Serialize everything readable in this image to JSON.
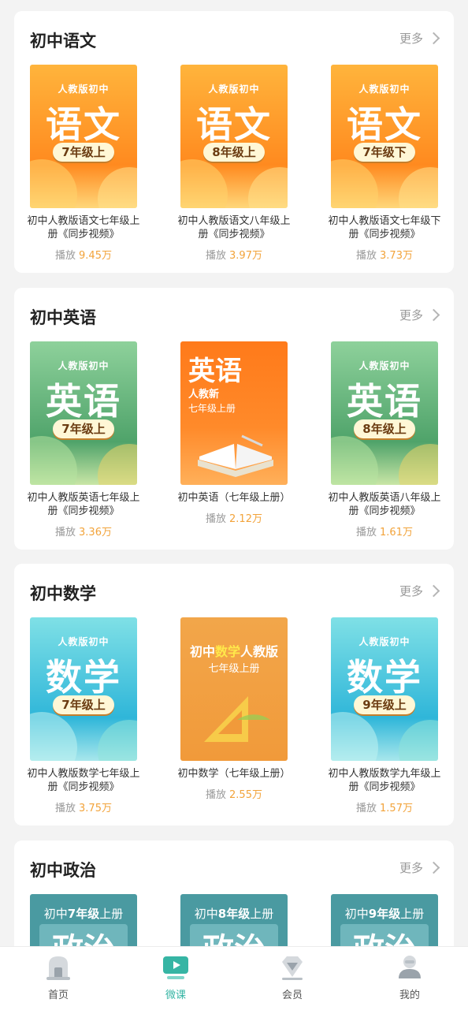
{
  "sections": [
    {
      "title": "初中语文",
      "more": "更多",
      "items": [
        {
          "name": "初中人教版语文七年级上册《同步视频》",
          "plays_label": "播放",
          "plays": "9.45万",
          "cover": {
            "publisher": "人教版初中",
            "subject": "语文",
            "grade": "7年级上",
            "theme": "orange"
          }
        },
        {
          "name": "初中人教版语文八年级上册《同步视频》",
          "plays_label": "播放",
          "plays": "3.97万",
          "cover": {
            "publisher": "人教版初中",
            "subject": "语文",
            "grade": "8年级上",
            "theme": "orange"
          }
        },
        {
          "name": "初中人教版语文七年级下册《同步视频》",
          "plays_label": "播放",
          "plays": "3.73万",
          "cover": {
            "publisher": "人教版初中",
            "subject": "语文",
            "grade": "7年级下",
            "theme": "orange"
          }
        }
      ]
    },
    {
      "title": "初中英语",
      "more": "更多",
      "items": [
        {
          "name": "初中人教版英语七年级上册《同步视频》",
          "plays_label": "播放",
          "plays": "3.36万",
          "cover": {
            "publisher": "人教版初中",
            "subject": "英语",
            "grade": "7年级上",
            "theme": "green"
          }
        },
        {
          "name": "初中英语（七年级上册）",
          "plays_label": "播放",
          "plays": "2.12万",
          "cover": {
            "subject": "英语",
            "line1": "人教新",
            "line2": "七年级上册",
            "theme": "english-tile"
          }
        },
        {
          "name": "初中人教版英语八年级上册《同步视频》",
          "plays_label": "播放",
          "plays": "1.61万",
          "cover": {
            "publisher": "人教版初中",
            "subject": "英语",
            "grade": "8年级上",
            "theme": "green"
          }
        }
      ]
    },
    {
      "title": "初中数学",
      "more": "更多",
      "items": [
        {
          "name": "初中人教版数学七年级上册《同步视频》",
          "plays_label": "播放",
          "plays": "3.75万",
          "cover": {
            "publisher": "人教版初中",
            "subject": "数学",
            "grade": "7年级上",
            "theme": "cyan"
          }
        },
        {
          "name": "初中数学（七年级上册）",
          "plays_label": "播放",
          "plays": "2.55万",
          "cover": {
            "prefix": "初中",
            "subject": "数学",
            "suffix": "人教版",
            "line2": "七年级上册",
            "theme": "math-tile"
          }
        },
        {
          "name": "初中人教版数学九年级上册《同步视频》",
          "plays_label": "播放",
          "plays": "1.57万",
          "cover": {
            "publisher": "人教版初中",
            "subject": "数学",
            "grade": "9年级上",
            "theme": "cyan"
          }
        }
      ]
    },
    {
      "title": "初中政治",
      "more": "更多",
      "items": [
        {
          "cover": {
            "prefix": "初中",
            "grade": "7年级",
            "suffix": "上册",
            "subject": "政治",
            "theme": "politics"
          }
        },
        {
          "cover": {
            "prefix": "初中",
            "grade": "8年级",
            "suffix": "上册",
            "subject": "政治",
            "theme": "politics"
          }
        },
        {
          "cover": {
            "prefix": "初中",
            "grade": "9年级",
            "suffix": "上册",
            "subject": "政治",
            "theme": "politics"
          }
        }
      ]
    }
  ],
  "tabbar": [
    {
      "label": "首页",
      "icon": "home-icon",
      "active": false
    },
    {
      "label": "微课",
      "icon": "video-lesson-icon",
      "active": true
    },
    {
      "label": "会员",
      "icon": "diamond-icon",
      "active": false
    },
    {
      "label": "我的",
      "icon": "profile-icon",
      "active": false
    }
  ],
  "colors": {
    "accent": "#36b5a4",
    "plays_number": "#f2a33a",
    "background": "#f3f3f3"
  }
}
